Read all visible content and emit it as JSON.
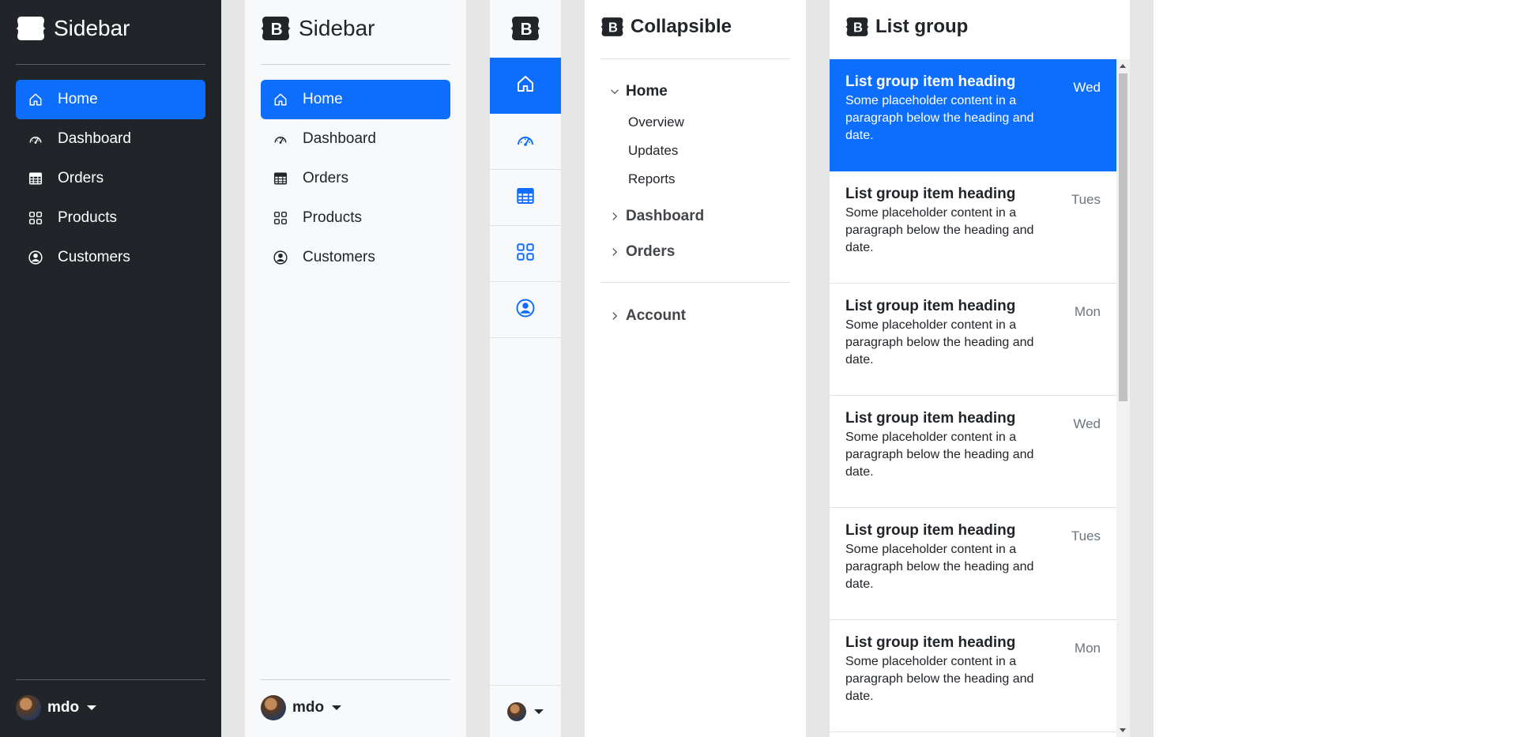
{
  "dark_sidebar": {
    "brand": "Sidebar",
    "items": [
      {
        "label": "Home",
        "icon": "home-icon",
        "active": true
      },
      {
        "label": "Dashboard",
        "icon": "speedometer-icon"
      },
      {
        "label": "Orders",
        "icon": "table-icon"
      },
      {
        "label": "Products",
        "icon": "grid-icon"
      },
      {
        "label": "Customers",
        "icon": "person-circle-icon"
      }
    ],
    "user": "mdo"
  },
  "light_sidebar": {
    "brand": "Sidebar",
    "items": [
      {
        "label": "Home",
        "icon": "home-icon",
        "active": true
      },
      {
        "label": "Dashboard",
        "icon": "speedometer-icon"
      },
      {
        "label": "Orders",
        "icon": "table-icon"
      },
      {
        "label": "Products",
        "icon": "grid-icon"
      },
      {
        "label": "Customers",
        "icon": "person-circle-icon"
      }
    ],
    "user": "mdo"
  },
  "icon_sidebar": {
    "items": [
      "home-icon",
      "speedometer-icon",
      "table-icon",
      "grid-icon",
      "person-circle-icon"
    ]
  },
  "collapsible": {
    "title": "Collapsible",
    "home": {
      "label": "Home",
      "subitems": [
        "Overview",
        "Updates",
        "Reports"
      ]
    },
    "dashboard": "Dashboard",
    "orders": "Orders",
    "account": "Account"
  },
  "list_group": {
    "title": "List group",
    "items": [
      {
        "heading": "List group item heading",
        "day": "Wed",
        "body": "Some placeholder content in a paragraph below the heading and date."
      },
      {
        "heading": "List group item heading",
        "day": "Tues",
        "body": "Some placeholder content in a paragraph below the heading and date."
      },
      {
        "heading": "List group item heading",
        "day": "Mon",
        "body": "Some placeholder content in a paragraph below the heading and date."
      },
      {
        "heading": "List group item heading",
        "day": "Wed",
        "body": "Some placeholder content in a paragraph below the heading and date."
      },
      {
        "heading": "List group item heading",
        "day": "Tues",
        "body": "Some placeholder content in a paragraph below the heading and date."
      },
      {
        "heading": "List group item heading",
        "day": "Mon",
        "body": "Some placeholder content in a paragraph below the heading and date."
      }
    ]
  },
  "colors": {
    "primary": "#0d6efd",
    "dark": "#212529",
    "light": "#f8f9fa"
  }
}
